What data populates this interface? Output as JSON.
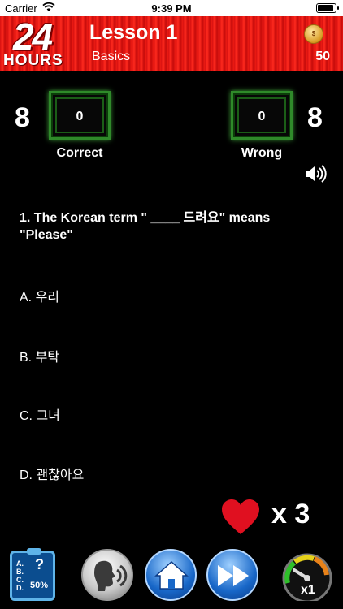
{
  "status_bar": {
    "carrier": "Carrier",
    "time": "9:39 PM"
  },
  "header": {
    "logo_number": "24",
    "logo_word": "HOURS",
    "lesson_title": "Lesson 1",
    "lesson_subtitle": "Basics",
    "coins": "50"
  },
  "scoreboard": {
    "correct_total": "8",
    "correct_value": "0",
    "correct_label": "Correct",
    "wrong_total": "8",
    "wrong_value": "0",
    "wrong_label": "Wrong"
  },
  "question": {
    "text": "1. The Korean term \" ____ 드려요\" means \"Please\"",
    "options": [
      "A. 우리",
      "B. 부탁",
      "C. 그녀",
      "D. 괜찮아요"
    ]
  },
  "lives": {
    "label": "x 3"
  },
  "toolbar": {
    "quiz_letters": "A.\nB.\nC.\nD.",
    "quiz_question_mark": "?",
    "quiz_percent": "50%",
    "speed_label": "x1"
  },
  "colors": {
    "header_red": "#e8160f",
    "score_green": "#2f8a2a",
    "heart_red": "#e01020",
    "button_blue": "#1867c8"
  },
  "icons": [
    "wifi-icon",
    "battery-icon",
    "coin-icon",
    "speaker-icon",
    "heart-icon",
    "quiz-clipboard-icon",
    "speak-face-icon",
    "home-icon",
    "fast-forward-icon",
    "speed-gauge-icon"
  ]
}
